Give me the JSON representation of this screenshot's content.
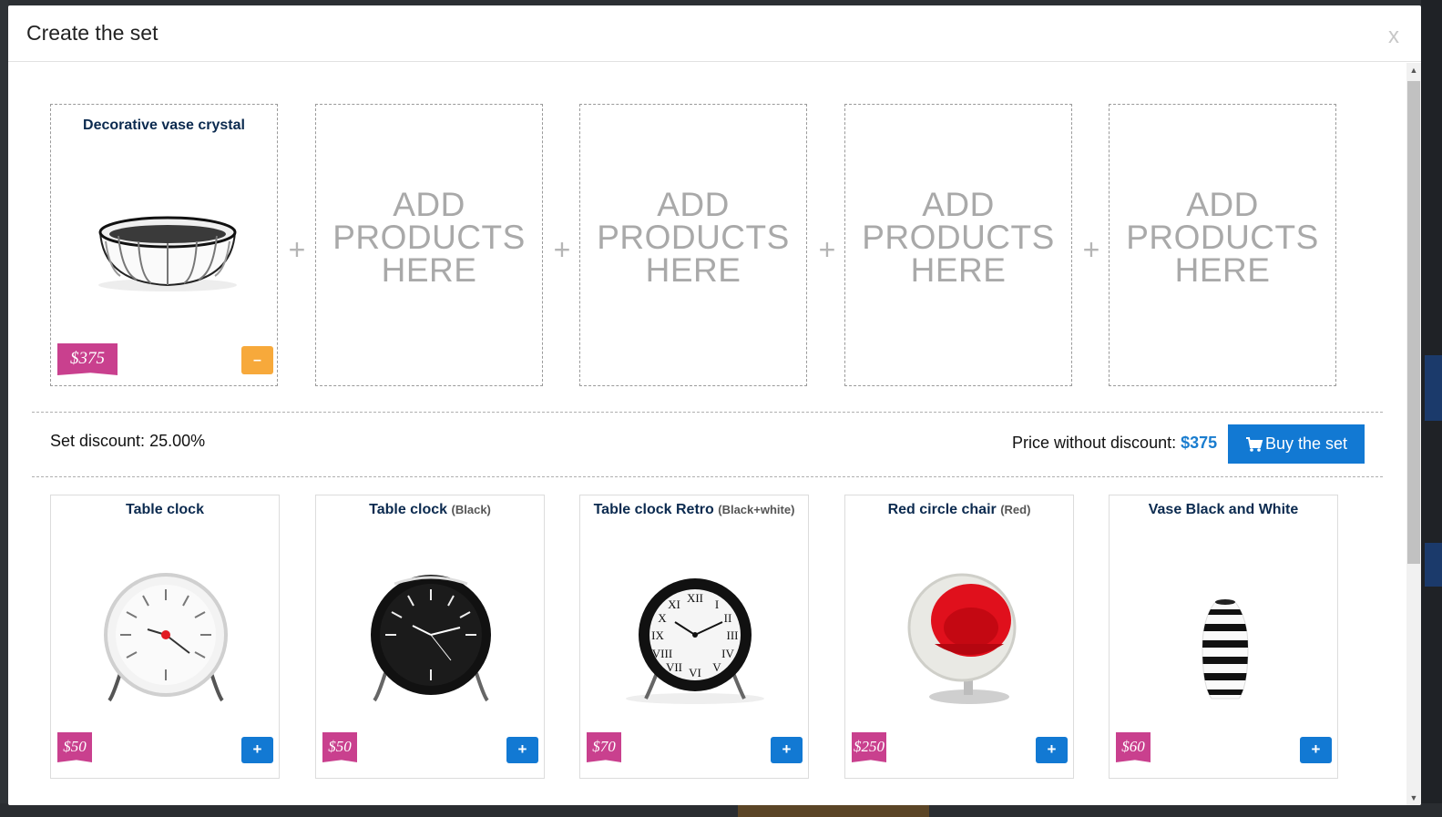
{
  "modal": {
    "title": "Create the set",
    "close_label": "x"
  },
  "set_slots": [
    {
      "filled": true,
      "title": "Decorative vase crystal",
      "price": "$375",
      "remove_label": "–"
    },
    {
      "filled": false,
      "placeholder": [
        "ADD",
        "PRODUCTS",
        "HERE"
      ]
    },
    {
      "filled": false,
      "placeholder": [
        "ADD",
        "PRODUCTS",
        "HERE"
      ]
    },
    {
      "filled": false,
      "placeholder": [
        "ADD",
        "PRODUCTS",
        "HERE"
      ]
    },
    {
      "filled": false,
      "placeholder": [
        "ADD",
        "PRODUCTS",
        "HERE"
      ]
    }
  ],
  "separator": "+",
  "summary": {
    "discount_label": "Set discount: 25.00%",
    "price_label": "Price without discount:",
    "price_value": "$375",
    "buy_label": "Buy the set"
  },
  "products": [
    {
      "name": "Table clock",
      "variant": "",
      "price": "$50",
      "add_label": "+",
      "image": "white-table-clock"
    },
    {
      "name": "Table clock",
      "variant": "(Black)",
      "price": "$50",
      "add_label": "+",
      "image": "black-table-clock"
    },
    {
      "name": "Table clock Retro",
      "variant": "(Black+white)",
      "price": "$70",
      "add_label": "+",
      "image": "retro-table-clock"
    },
    {
      "name": "Red circle chair",
      "variant": "(Red)",
      "price": "$250",
      "add_label": "+",
      "image": "ball-chair"
    },
    {
      "name": "Vase Black and White",
      "variant": "",
      "price": "$60",
      "add_label": "+",
      "image": "striped-vase"
    }
  ],
  "colors": {
    "price_tag": "#c9408e",
    "primary_button": "#1279d3",
    "remove_button": "#f7a93b",
    "title_text": "#0b2a4f"
  }
}
